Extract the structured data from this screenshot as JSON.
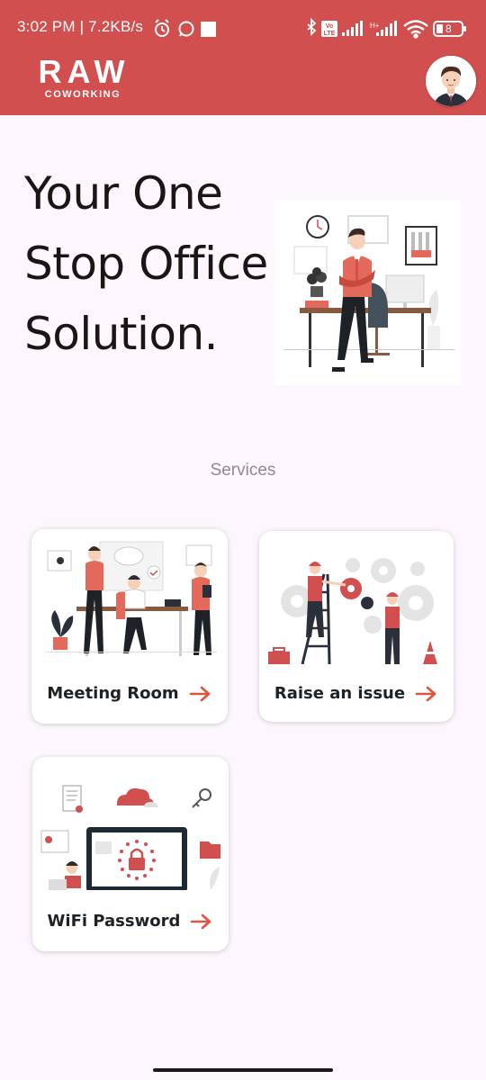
{
  "status_bar": {
    "time": "3:02 PM | 7.2KB/s",
    "battery": "8",
    "icons": [
      "alarm-icon",
      "whatsapp-icon",
      "notification-square-icon",
      "bluetooth-icon",
      "volte-icon",
      "signal-icon",
      "hplus-signal-icon",
      "wifi-icon",
      "battery-icon"
    ]
  },
  "header": {
    "brand_name": "RAW",
    "brand_sub": "COWORKING",
    "avatar_icon": "user-avatar-icon"
  },
  "hero": {
    "title": "Your One Stop Office Solution."
  },
  "services": {
    "label": "Services",
    "items": [
      {
        "label": "Meeting Room",
        "icon": "meeting-room-illustration"
      },
      {
        "label": "Raise an issue",
        "icon": "repair-illustration"
      },
      {
        "label": "WiFi Password",
        "icon": "wifi-security-illustration"
      }
    ]
  },
  "colors": {
    "primary": "#d14f4f",
    "accent_arrow": "#e0533d",
    "background": "#fcf7fc",
    "title_text": "#1b1616"
  }
}
